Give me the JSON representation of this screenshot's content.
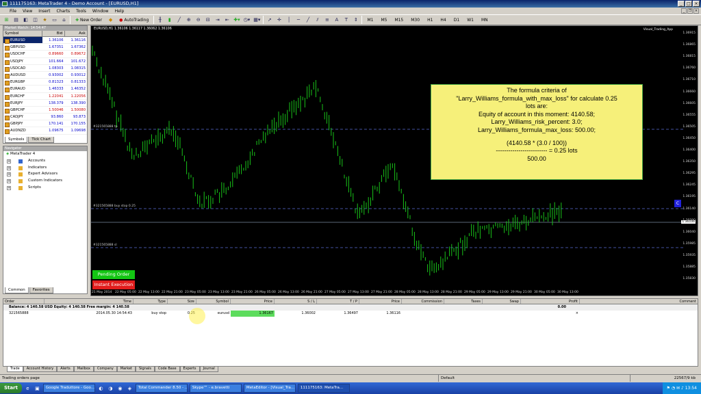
{
  "window": {
    "title": "111175163: MetaTrader 4 - Demo Account - [EURUSD,H1]"
  },
  "menu": [
    "File",
    "View",
    "Insert",
    "Charts",
    "Tools",
    "Window",
    "Help"
  ],
  "toolbar": {
    "new_order": "New Order",
    "autotrading": "AutoTrading"
  },
  "market_watch": {
    "header": "Market Watch: 14:54:47",
    "col_symbol": "Symbol",
    "col_bid": "Bid",
    "col_ask": "Ask",
    "rows": [
      {
        "symbol": "EURUSD",
        "bid": "1.36106",
        "ask": "1.36116",
        "color": "blue"
      },
      {
        "symbol": "GBPUSD",
        "bid": "1.67351",
        "ask": "1.67362",
        "color": "blue"
      },
      {
        "symbol": "USDCHF",
        "bid": "0.89660",
        "ask": "0.89672",
        "color": "red"
      },
      {
        "symbol": "USDJPY",
        "bid": "101.664",
        "ask": "101.672",
        "color": "blue"
      },
      {
        "symbol": "USDCAD",
        "bid": "1.08303",
        "ask": "1.08315",
        "color": "blue"
      },
      {
        "symbol": "AUDUSD",
        "bid": "0.93002",
        "ask": "0.93012",
        "color": "blue"
      },
      {
        "symbol": "EURGBP",
        "bid": "0.81323",
        "ask": "0.81333",
        "color": "blue"
      },
      {
        "symbol": "EURAUD",
        "bid": "1.46333",
        "ask": "1.46352",
        "color": "blue"
      },
      {
        "symbol": "EURCHF",
        "bid": "1.22041",
        "ask": "1.22056",
        "color": "red"
      },
      {
        "symbol": "EURJPY",
        "bid": "138.379",
        "ask": "138.390",
        "color": "blue"
      },
      {
        "symbol": "GBPCHF",
        "bid": "1.50046",
        "ask": "1.50080",
        "color": "red"
      },
      {
        "symbol": "CADJPY",
        "bid": "93.860",
        "ask": "93.873",
        "color": "blue"
      },
      {
        "symbol": "GBPJPY",
        "bid": "170.141",
        "ask": "170.155",
        "color": "blue"
      },
      {
        "symbol": "AUDNZD",
        "bid": "1.09675",
        "ask": "1.09698",
        "color": "blue"
      }
    ],
    "tabs": [
      "Symbols",
      "Tick Chart"
    ]
  },
  "navigator": {
    "header": "Navigator",
    "root": "MetaTrader 4",
    "items": [
      "Accounts",
      "Indicators",
      "Expert Advisors",
      "Custom Indicators",
      "Scripts"
    ],
    "tabs": [
      "Common",
      "Favorites"
    ]
  },
  "chart": {
    "title": "EURUSD,H1  1.36106 1.36117 1.36062 1.36106",
    "ea_label": "Visual_Trading_App",
    "line_tp": "#321565888 tp",
    "line_buystop": "#321565888 buy stop 0.25",
    "line_sl": "#321565888 sl",
    "current_price": "1.36106",
    "price_labels": [
      "1.36915",
      "1.36865",
      "1.36815",
      "1.36760",
      "1.36710",
      "1.36660",
      "1.36605",
      "1.36555",
      "1.36505",
      "1.36450",
      "1.36400",
      "1.36350",
      "1.36295",
      "1.36245",
      "1.36195",
      "1.36140",
      "1.36090",
      "1.36040",
      "1.35985",
      "1.35935",
      "1.35885",
      "1.35830"
    ],
    "time_labels": [
      "21 May 2014",
      "22 May 05:00",
      "22 May 13:00",
      "22 May 21:00",
      "23 May 05:00",
      "23 May 13:00",
      "23 May 21:00",
      "26 May 05:00",
      "26 May 13:00",
      "26 May 21:00",
      "27 May 05:00",
      "27 May 13:00",
      "27 May 21:00",
      "28 May 05:00",
      "28 May 13:00",
      "28 May 21:00",
      "29 May 05:00",
      "29 May 13:00",
      "29 May 21:00",
      "30 May 05:00",
      "30 May 13:00"
    ],
    "pending_order": "Pending Order",
    "instant_execution": "Instant Execution",
    "c_badge": "C"
  },
  "note": {
    "l1": "The formula criteria of",
    "l2": "\"Larry_Williams_formula_with_max_loss\" for calculate 0.25",
    "l3": "lots are:",
    "l4": "Equity of account in this moment: 4140.58;",
    "l5": "Larry_Williams_risk_percent: 3.0;",
    "l6": "Larry_Williams_formula_max_loss: 500.00;",
    "l7": "(4140.58 * (3.0 / 100))",
    "l8": "-------------------------   =   0.25 lots",
    "l9": "500.00"
  },
  "terminal": {
    "cols": [
      "Order",
      "Time",
      "Type",
      "Size",
      "Symbol",
      "Price",
      "S / L",
      "T / P",
      "Price",
      "Commission",
      "Taxes",
      "Swap",
      "Profit",
      "Comment"
    ],
    "balance": "Balance: 4 140.58 USD  Equity: 4 140.58  Free margin: 4 140.58",
    "balance_profit": "0.00",
    "order": {
      "id": "321565888",
      "time": "2014.05.30 14:54:43",
      "type": "buy stop",
      "size": "0.25",
      "symbol": "eurusd",
      "price": "1.36167",
      "sl": "1.36002",
      "tp": "1.36497",
      "cur": "1.36116",
      "close": "×"
    },
    "tabs": [
      "Trade",
      "Account History",
      "Alerts",
      "Mailbox",
      "Company",
      "Market",
      "Signals",
      "Code Base",
      "Experts",
      "Journal"
    ]
  },
  "status": {
    "left": "Trading orders page",
    "profile": "Default",
    "traffic": "22567/9 kb"
  },
  "taskbar": {
    "start": "Start",
    "tasks": [
      "Google Traduttore - Goo...",
      "Total Commander 8.50 - ...",
      "Skype™ - e.bravetti",
      "MetaEditor - [Visual_Tra...",
      "111175163: MetaTra..."
    ],
    "clock": "13:54"
  }
}
